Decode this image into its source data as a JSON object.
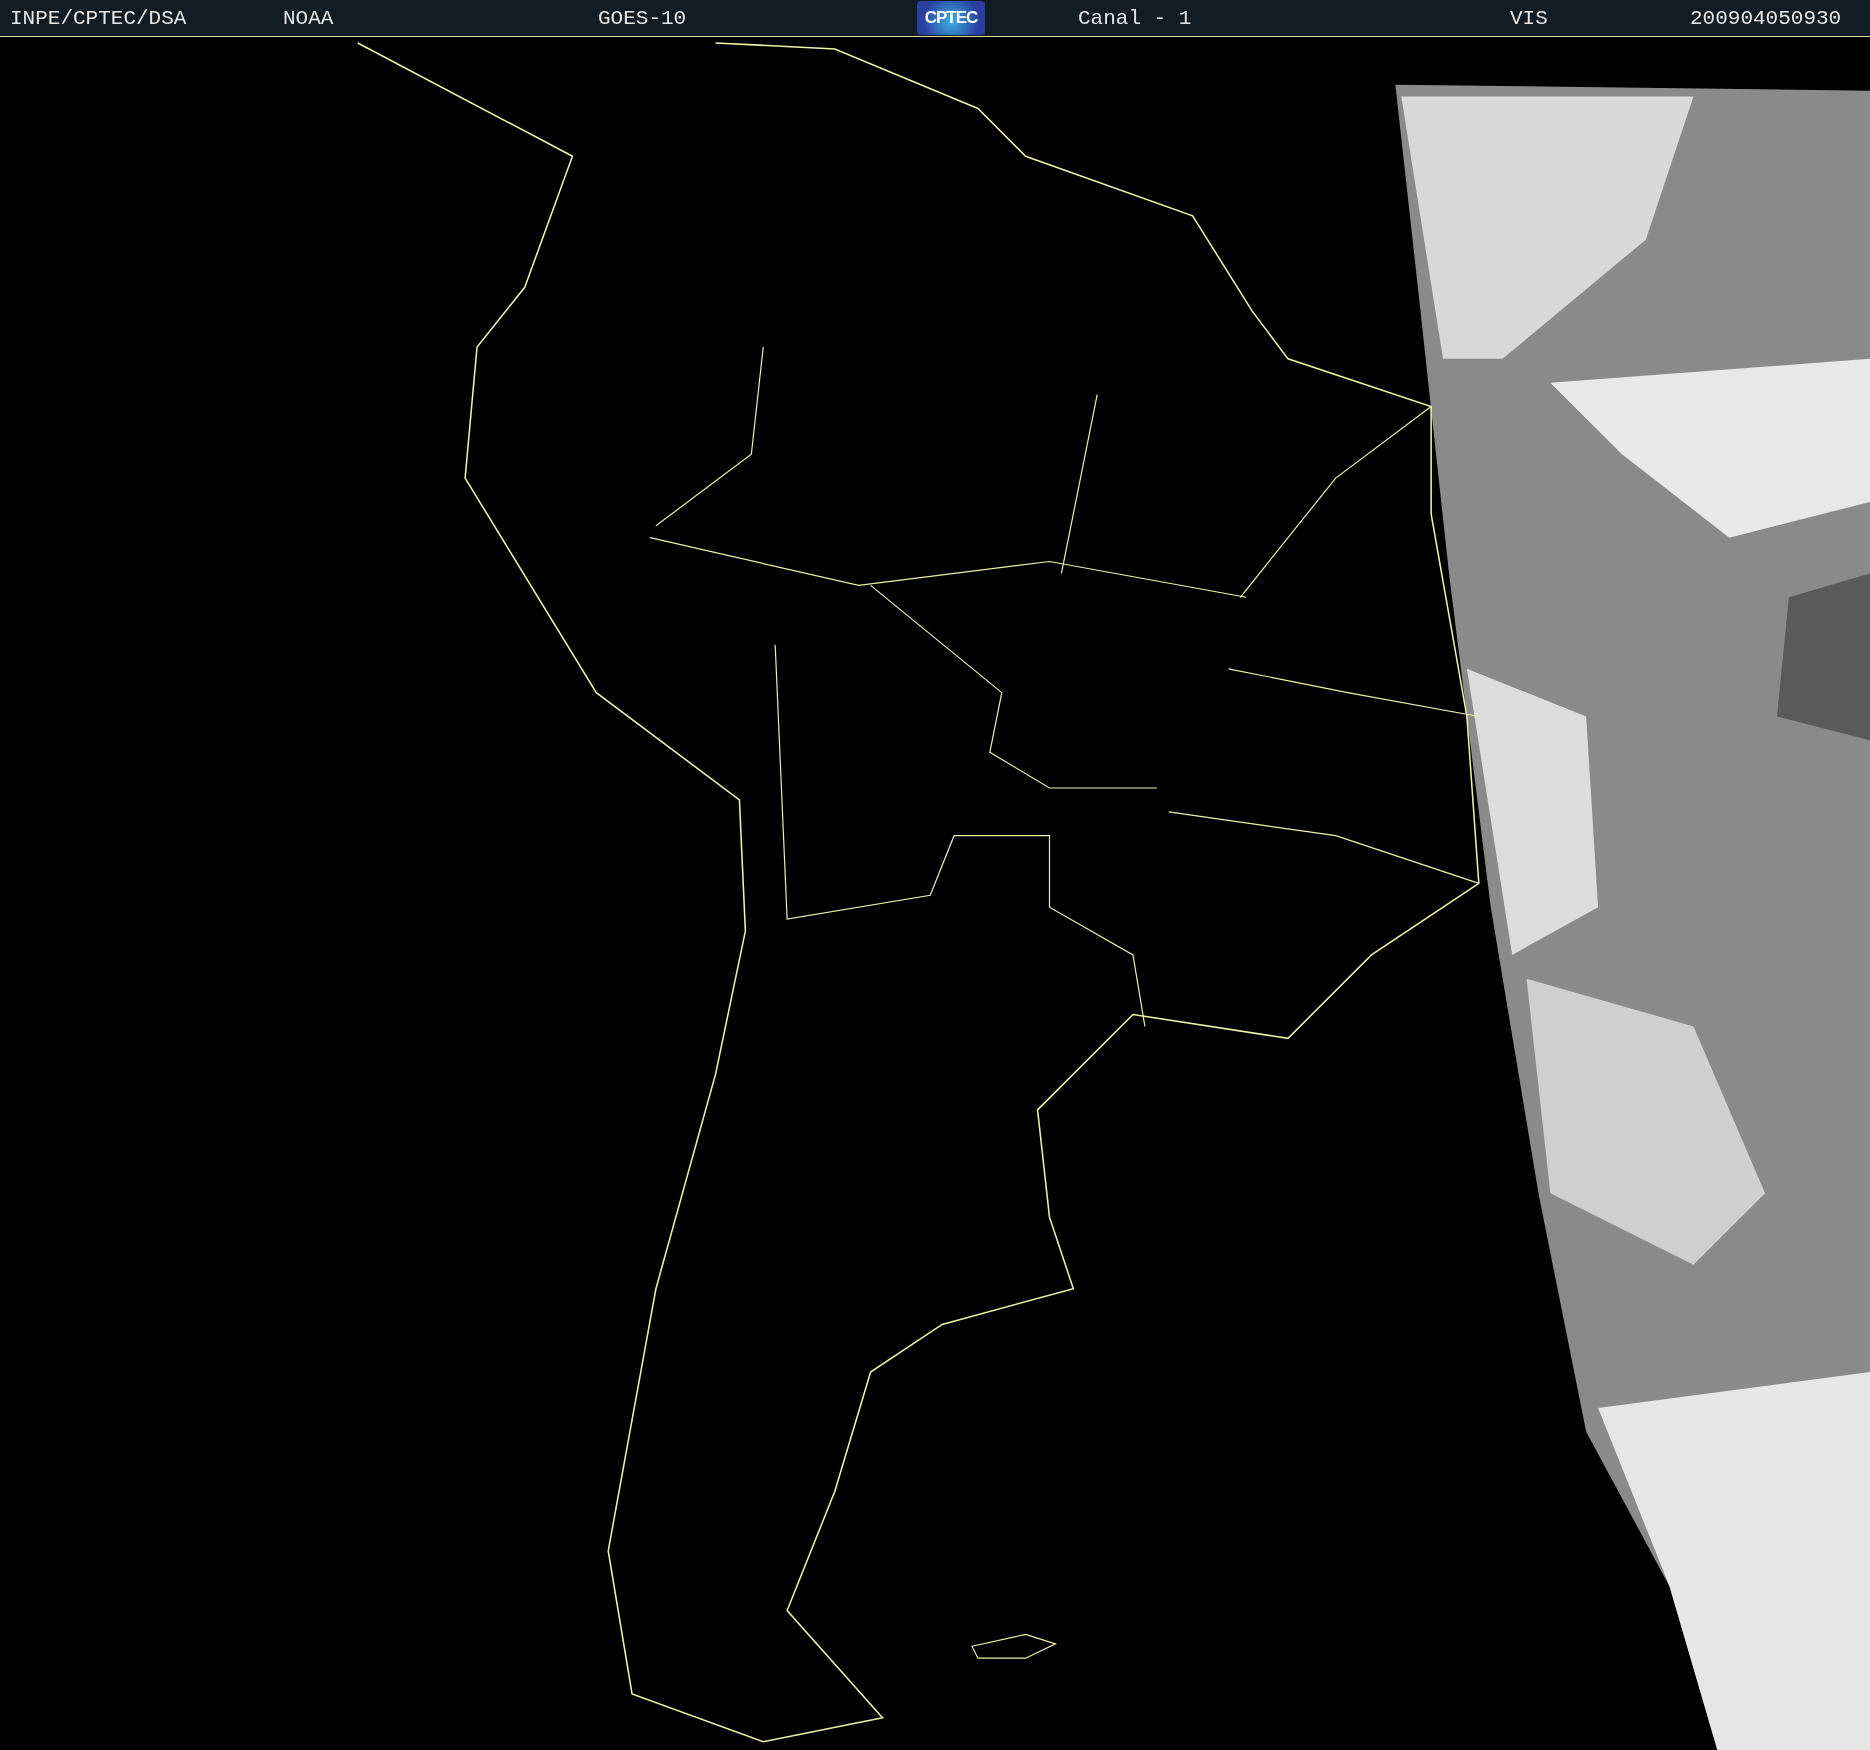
{
  "header": {
    "institution": "INPE/CPTEC/DSA",
    "agency": "NOAA",
    "satellite": "GOES-10",
    "logo": "CPTEC",
    "channel": "Canal - 1",
    "band": "VIS",
    "timestamp": "200904050930"
  }
}
